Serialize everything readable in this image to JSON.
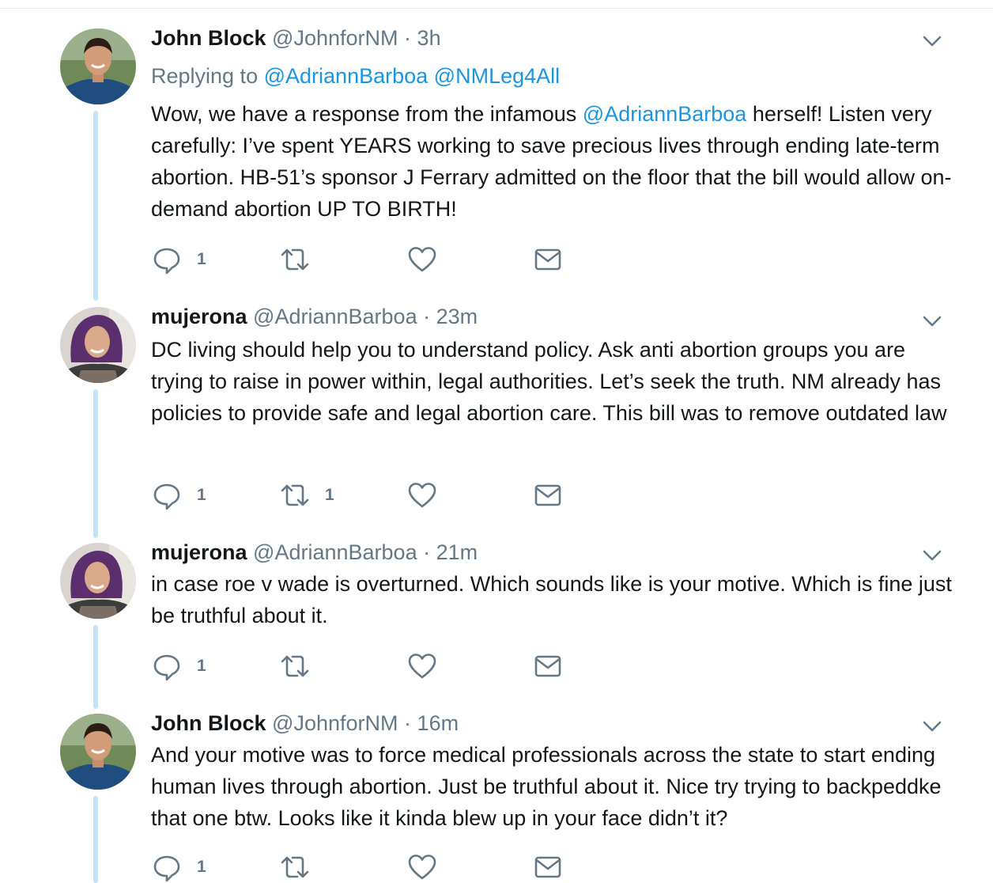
{
  "tweets": [
    {
      "name": "John Block",
      "handle": "@JohnforNM",
      "dot": "·",
      "time": "3h",
      "avatar": "john-block-avatar",
      "reply_to": {
        "prefix": "Replying to",
        "mentions": [
          "@AdriannBarboa",
          "@NMLeg4All"
        ]
      },
      "text_parts": [
        "Wow, we have a response from the infamous ",
        "@AdriannBarboa",
        " herself! Listen very carefully: I’ve spent YEARS working to save precious lives through ending late-term abortion. HB-51’s sponsor J Ferrary admitted on the floor that the bill would allow on-demand abortion UP TO BIRTH!"
      ],
      "reply_count": "1",
      "retweet_count": "",
      "like_count": ""
    },
    {
      "name": "mujerona",
      "handle": "@AdriannBarboa",
      "dot": "·",
      "time": "23m",
      "avatar": "mujerona-avatar",
      "text": "DC living should help you to understand policy. Ask anti abortion groups you are trying to raise in power within, legal authorities. Let’s seek the truth. NM already has policies to provide safe and legal abortion care. This bill was to remove outdated law",
      "reply_count": "1",
      "retweet_count": "1",
      "like_count": ""
    },
    {
      "name": "mujerona",
      "handle": "@AdriannBarboa",
      "dot": "·",
      "time": "21m",
      "avatar": "mujerona-avatar",
      "text": "in case roe v wade is overturned. Which sounds like is your motive. Which is fine just be truthful about it.",
      "reply_count": "1",
      "retweet_count": "",
      "like_count": ""
    },
    {
      "name": "John Block",
      "handle": "@JohnforNM",
      "dot": "·",
      "time": "16m",
      "avatar": "john-block-avatar",
      "text": "And your motive was to force medical professionals across the state to start ending human lives through abortion. Just be truthful about it. Nice try trying to backpeddke that one btw. Looks like it kinda blew up in your face didn’t it?",
      "reply_count": "1",
      "retweet_count": "",
      "like_count": ""
    }
  ],
  "icons": {
    "reply": "reply-icon",
    "retweet": "retweet-icon",
    "like": "heart-icon",
    "dm": "envelope-icon",
    "more": "chevron-down-icon"
  },
  "colors": {
    "link": "#1b95e0",
    "secondary_text": "#657786",
    "thread_line": "#c4e3f7"
  }
}
